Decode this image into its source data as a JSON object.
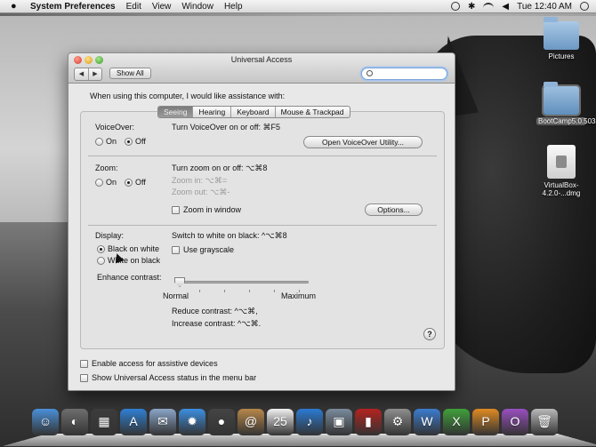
{
  "menubar": {
    "app_name": "System Preferences",
    "menus": [
      "Edit",
      "View",
      "Window",
      "Help"
    ],
    "clock": "Tue 12:40 AM"
  },
  "desktop": {
    "icons": [
      {
        "label": "Pictures"
      },
      {
        "label": "BootCamp5.0.5033"
      },
      {
        "label": "VirtualBox-4.2.0-...dmg"
      }
    ]
  },
  "window": {
    "title": "Universal Access",
    "show_all_label": "Show All",
    "search_placeholder": "",
    "back_glyph": "◀",
    "forward_glyph": "▶",
    "prompt": "When using this computer, I would like assistance with:",
    "tabs": [
      {
        "label": "Seeing",
        "selected": true
      },
      {
        "label": "Hearing",
        "selected": false
      },
      {
        "label": "Keyboard",
        "selected": false
      },
      {
        "label": "Mouse & Trackpad",
        "selected": false
      }
    ],
    "voiceover": {
      "label": "VoiceOver:",
      "on_label": "On",
      "off_label": "Off",
      "value": "Off",
      "shortcut_text": "Turn VoiceOver on or off: ⌘F5",
      "utility_button": "Open VoiceOver Utility..."
    },
    "zoom": {
      "label": "Zoom:",
      "on_label": "On",
      "off_label": "Off",
      "value": "Off",
      "shortcut_text": "Turn zoom on or off: ⌥⌘8",
      "zoom_in_text": "Zoom in: ⌥⌘=",
      "zoom_out_text": "Zoom out: ⌥⌘-",
      "zoom_in_window_label": "Zoom in window",
      "zoom_in_window_checked": false,
      "options_button": "Options..."
    },
    "display": {
      "label": "Display:",
      "black_on_white_label": "Black on white",
      "white_on_black_label": "White on black",
      "value": "Black on white",
      "switch_text": "Switch to white on black: ^⌥⌘8",
      "grayscale_label": "Use grayscale",
      "grayscale_checked": false,
      "enhance_label": "Enhance contrast:",
      "contrast_level": 0,
      "min_label": "Normal",
      "max_label": "Maximum",
      "reduce_text": "Reduce contrast: ^⌥⌘,",
      "increase_text": "Increase contrast: ^⌥⌘."
    },
    "help_glyph": "?",
    "footer": {
      "assistive_label": "Enable access for assistive devices",
      "assistive_checked": false,
      "status_label": "Show Universal Access status in the menu bar",
      "status_checked": false
    }
  },
  "dock": {
    "items": [
      {
        "icon": "finder-icon",
        "color": "#4a90d9",
        "glyph": "☺"
      },
      {
        "icon": "dashboard-icon",
        "color": "#6e6e6e",
        "glyph": "◐"
      },
      {
        "icon": "mission-control-icon",
        "color": "#3c3c3c",
        "glyph": "▦"
      },
      {
        "icon": "app-store-icon",
        "color": "#2f7fd3",
        "glyph": "A"
      },
      {
        "icon": "mail-icon",
        "color": "#8aa5c8",
        "glyph": "✉"
      },
      {
        "icon": "safari-icon",
        "color": "#3c8ee0",
        "glyph": "✹"
      },
      {
        "icon": "facetime-icon",
        "color": "#444444",
        "glyph": "●"
      },
      {
        "icon": "address-book-icon",
        "color": "#b8874a",
        "glyph": "@"
      },
      {
        "icon": "ical-icon",
        "color": "#f2f2f2",
        "glyph": "25"
      },
      {
        "icon": "itunes-icon",
        "color": "#2a7ad3",
        "glyph": "♪"
      },
      {
        "icon": "preview-icon",
        "color": "#7a8b9c",
        "glyph": "▣"
      },
      {
        "icon": "photo-booth-icon",
        "color": "#b4231f",
        "glyph": "▮"
      },
      {
        "icon": "system-preferences-icon",
        "color": "#8e8e8e",
        "glyph": "⚙"
      },
      {
        "icon": "word-icon",
        "color": "#3b7ccf",
        "glyph": "W"
      },
      {
        "icon": "excel-icon",
        "color": "#3fa03a",
        "glyph": "X"
      },
      {
        "icon": "powerpoint-icon",
        "color": "#e08a22",
        "glyph": "P"
      },
      {
        "icon": "onenote-icon",
        "color": "#9a4fc0",
        "glyph": "O"
      },
      {
        "icon": "trash-icon",
        "color": "#b9b9b9",
        "glyph": "🗑"
      }
    ]
  }
}
